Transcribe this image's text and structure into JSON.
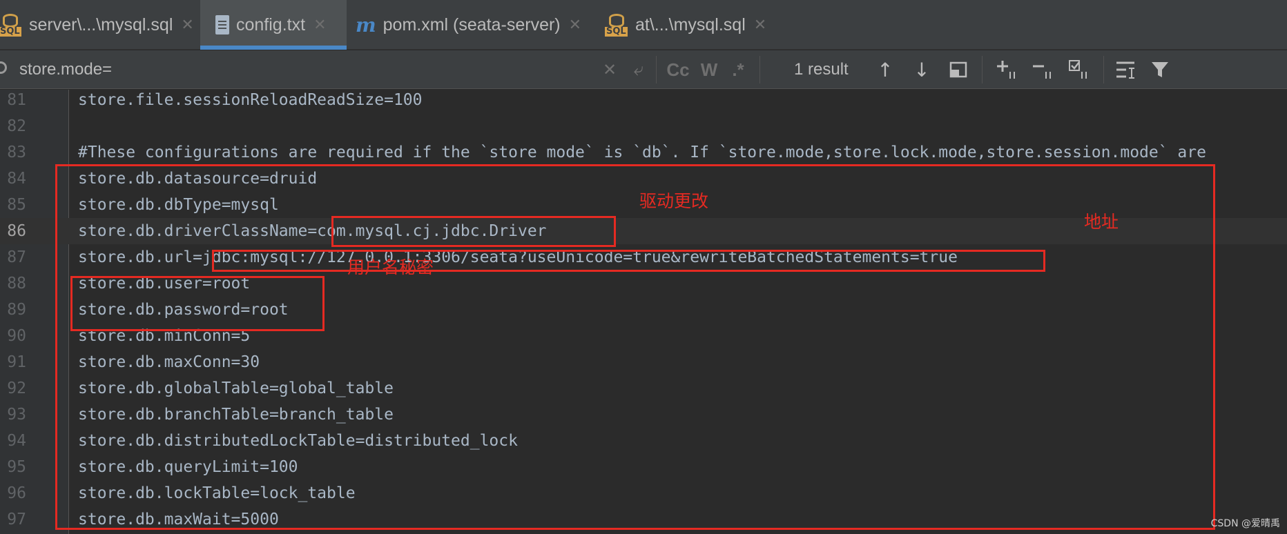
{
  "tabs": [
    {
      "label": "server\\...\\mysql.sql",
      "icon": "sql-file-icon",
      "active": false
    },
    {
      "label": "config.txt",
      "icon": "text-file-icon",
      "active": true
    },
    {
      "label": "pom.xml (seata-server)",
      "icon": "maven-icon",
      "active": false
    },
    {
      "label": "at\\...\\mysql.sql",
      "icon": "sql-file-icon",
      "active": false
    }
  ],
  "search": {
    "value": "store.mode=",
    "result_count": "1 result",
    "case_label": "Cc",
    "word_label": "W",
    "regex_label": ".*"
  },
  "editor": {
    "current_line": "86",
    "lines": [
      {
        "num": "81",
        "text": "store.file.sessionReloadReadSize=100"
      },
      {
        "num": "82",
        "text": ""
      },
      {
        "num": "83",
        "text": "#These configurations are required if the `store mode` is `db`. If `store.mode,store.lock.mode,store.session.mode` are"
      },
      {
        "num": "84",
        "text": "store.db.datasource=druid"
      },
      {
        "num": "85",
        "text": "store.db.dbType=mysql"
      },
      {
        "num": "86",
        "text": "store.db.driverClassName=com.mysql.cj.jdbc.Driver"
      },
      {
        "num": "87",
        "text": "store.db.url=jdbc:mysql://127.0.0.1:3306/seata?useUnicode=true&rewriteBatchedStatements=true"
      },
      {
        "num": "88",
        "text": "store.db.user=root"
      },
      {
        "num": "89",
        "text": "store.db.password=root"
      },
      {
        "num": "90",
        "text": "store.db.minConn=5"
      },
      {
        "num": "91",
        "text": "store.db.maxConn=30"
      },
      {
        "num": "92",
        "text": "store.db.globalTable=global_table"
      },
      {
        "num": "93",
        "text": "store.db.branchTable=branch_table"
      },
      {
        "num": "94",
        "text": "store.db.distributedLockTable=distributed_lock"
      },
      {
        "num": "95",
        "text": "store.db.queryLimit=100"
      },
      {
        "num": "96",
        "text": "store.db.lockTable=lock_table"
      },
      {
        "num": "97",
        "text": "store.db.maxWait=5000"
      }
    ]
  },
  "annotations": {
    "driver": "驱动更改",
    "url": "地址",
    "credentials": "用户名秘密",
    "color": "#e52a22"
  },
  "watermark": "CSDN @爱晴禹",
  "colors": {
    "background": "#2b2b2b",
    "tab_accent": "#4a88c7",
    "code_text": "#a9b7c6"
  }
}
